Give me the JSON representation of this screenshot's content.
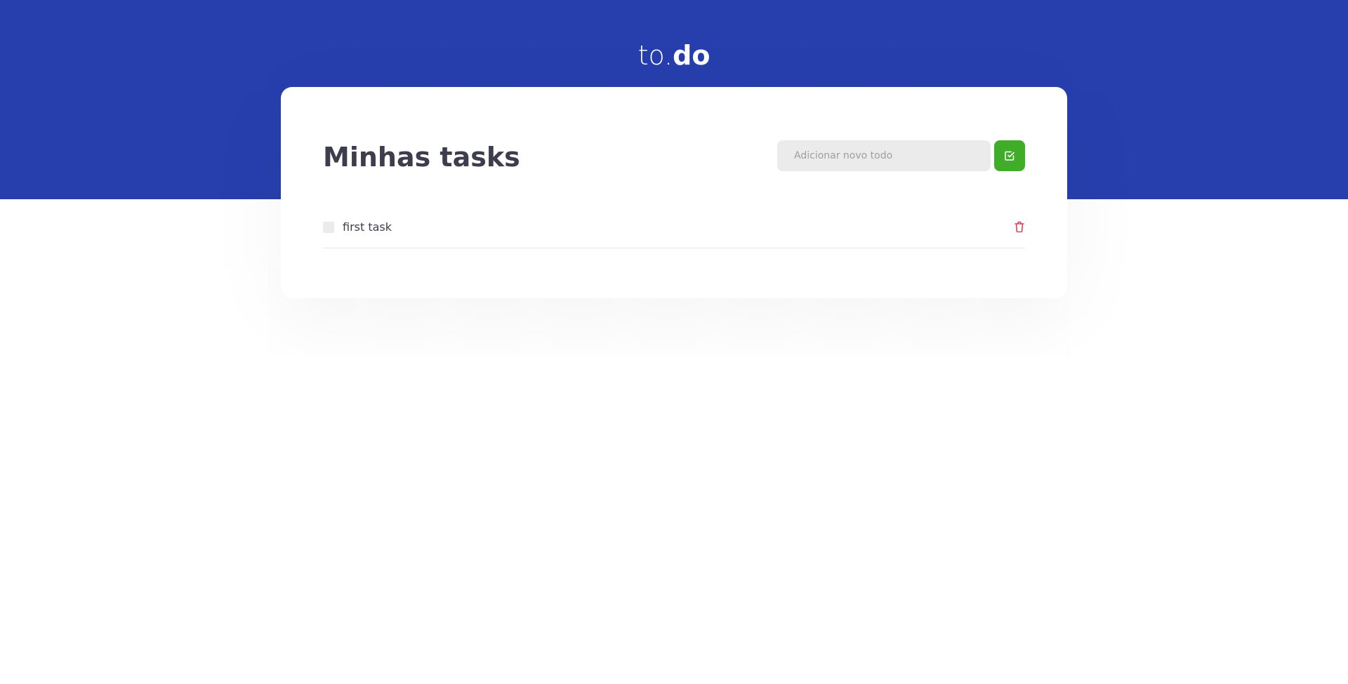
{
  "logo": {
    "light": "to.",
    "bold": "do"
  },
  "main": {
    "title": "Minhas tasks",
    "new_todo": {
      "placeholder": "Adicionar novo todo",
      "value": ""
    },
    "add_button_icon": "check-square-icon",
    "tasks": [
      {
        "text": "first task",
        "completed": false,
        "delete_icon": "trash-icon"
      }
    ]
  },
  "colors": {
    "header_background": "#273fad",
    "accent_green": "#3fad27",
    "delete_red": "#e83f5b",
    "title_text": "#3d3d4d"
  }
}
